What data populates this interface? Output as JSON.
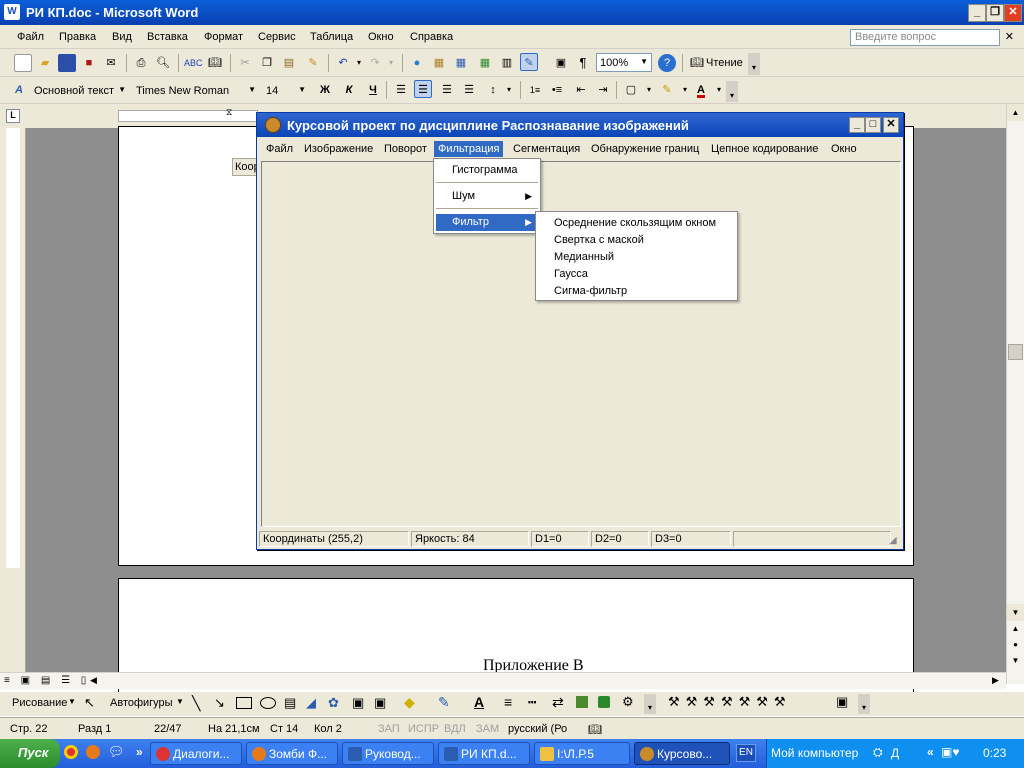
{
  "word": {
    "title": "РИ КП.doc - Microsoft Word",
    "menu": [
      "Файл",
      "Правка",
      "Вид",
      "Вставка",
      "Формат",
      "Сервис",
      "Таблица",
      "Окно",
      "Справка"
    ],
    "ask_placeholder": "Введите вопрос",
    "zoom": "100%",
    "read_label": "Чтение",
    "style": "Основной текст",
    "font": "Times New Roman",
    "size": "14",
    "bold": "Ж",
    "italic": "К",
    "underline": "Ч",
    "page_text": "Приложение В",
    "partial_label": "Коор"
  },
  "app": {
    "title": "Курсовой проект по дисциплине Распознавание изображений",
    "menu": [
      "Файл",
      "Изображение",
      "Поворот",
      "Фильтрация",
      "Сегментация",
      "Обнаружение границ",
      "Цепное кодирование",
      "Окно"
    ],
    "filter_menu": {
      "items": [
        "Гистограмма",
        "Шум",
        "Фильтр"
      ]
    },
    "submenu": [
      "Осреднение скользящим окном",
      "Свертка с маской",
      "Медианный",
      "Гаусса",
      "Сигма-фильтр"
    ],
    "status": {
      "coords": "Координаты (255,2)",
      "brightness": "Яркость: 84",
      "d1": "D1=0",
      "d2": "D2=0",
      "d3": "D3=0"
    }
  },
  "drawbar": {
    "drawing": "Рисование",
    "autoshapes": "Автофигуры"
  },
  "status": {
    "page": "Стр. 22",
    "section": "Разд 1",
    "pages": "22/47",
    "at": "На 21,1см",
    "line": "Ст 14",
    "col": "Кол 2",
    "rec": "ЗАП",
    "trk": "ИСПР",
    "ext": "ВДЛ",
    "ovr": "ЗАМ",
    "lang": "русский (Ро"
  },
  "taskbar": {
    "start": "Пуск",
    "tasks": [
      "Диалоги...",
      "Зомби Ф...",
      "Руковод...",
      "РИ КП.d...",
      "I:\\Л.Р.5",
      "Курсово..."
    ],
    "lang": "EN",
    "my_computer": "Мой компьютер",
    "tray_letter": "Д",
    "clock": "0:23"
  },
  "colors": {
    "title_blue": "#0a5fd8",
    "menu_highlight": "#316ac5",
    "face": "#ece9d8"
  }
}
